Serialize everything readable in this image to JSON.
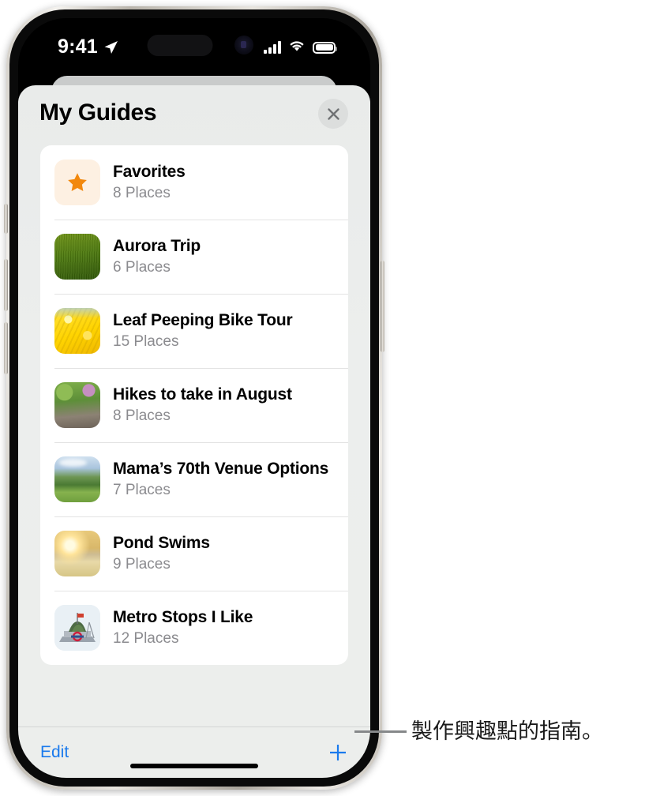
{
  "status_bar": {
    "time": "9:41",
    "location_icon": "location-arrow-icon",
    "signal_icon": "cellular-signal-icon",
    "wifi_icon": "wifi-icon",
    "battery_icon": "battery-icon"
  },
  "sheet": {
    "title": "My Guides",
    "close_icon": "close-icon"
  },
  "guides": [
    {
      "title": "Favorites",
      "places": "8 Places",
      "thumb": "star-icon",
      "thumb_class": "th-fav"
    },
    {
      "title": "Aurora Trip",
      "places": "6 Places",
      "thumb": "grass-photo",
      "thumb_class": "th-grass"
    },
    {
      "title": "Leaf Peeping Bike Tour",
      "places": "15 Places",
      "thumb": "yellow-leaves-photo",
      "thumb_class": "th-leaf"
    },
    {
      "title": "Hikes to take in August",
      "places": "8 Places",
      "thumb": "forest-trail-photo",
      "thumb_class": "th-forest"
    },
    {
      "title": "Mama’s 70th Venue Options",
      "places": "7 Places",
      "thumb": "meadow-photo",
      "thumb_class": "th-meadow"
    },
    {
      "title": "Pond Swims",
      "places": "9 Places",
      "thumb": "sunset-pond-photo",
      "thumb_class": "th-pond"
    },
    {
      "title": "Metro Stops I Like",
      "places": "12 Places",
      "thumb": "metro-station-photo",
      "thumb_class": "th-metro"
    }
  ],
  "toolbar": {
    "edit_label": "Edit",
    "add_icon": "plus-icon"
  },
  "annotation": {
    "text": "製作興趣點的指南。"
  },
  "colors": {
    "accent_blue": "#1a7aed",
    "star_orange": "#f2880d",
    "sheet_bg": "#eceeed",
    "card_bg": "#ffffff",
    "subtitle_gray": "#8b8b8f"
  }
}
